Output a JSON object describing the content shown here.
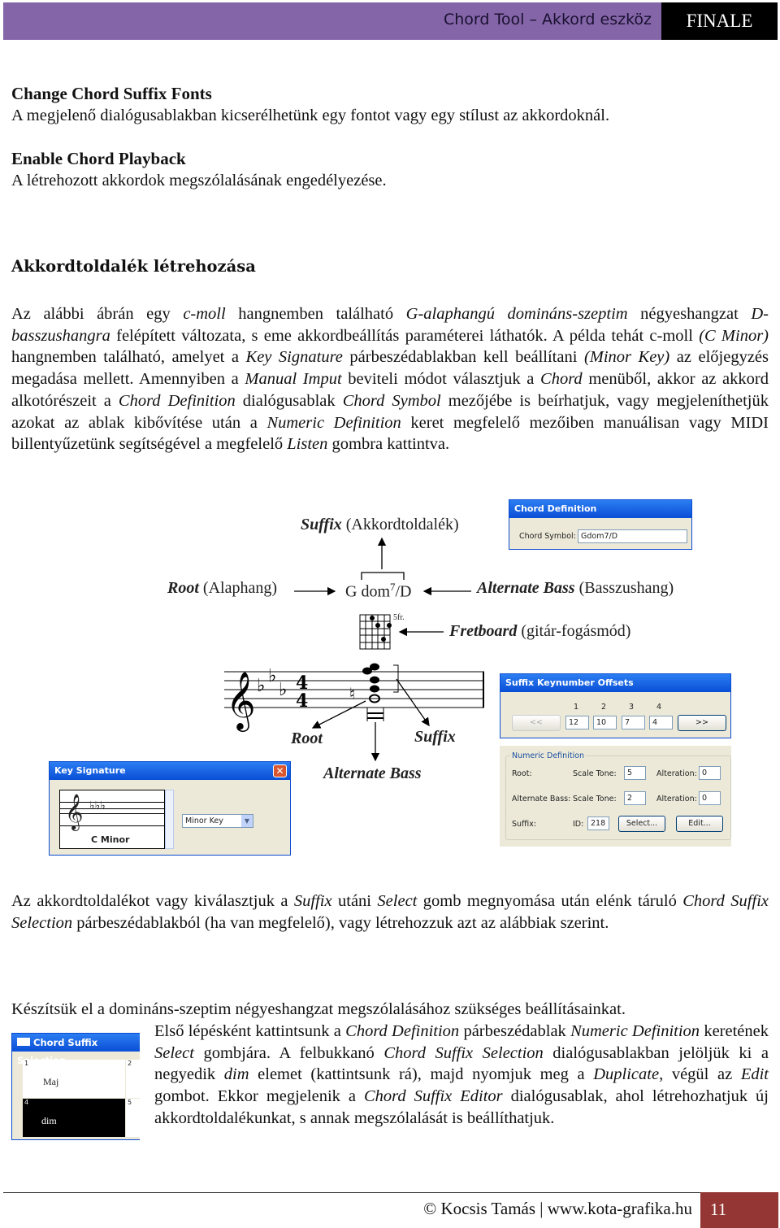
{
  "header": {
    "title": "Chord Tool – Akkord eszköz",
    "brand": "FINALE",
    "accent": "#8466a8"
  },
  "sections": [
    {
      "title": "Change Chord Suffix Fonts",
      "text": "A megjelenő dialógusablakban kicserélhetünk egy fontot vagy egy stílust az akkordoknál."
    },
    {
      "title": "Enable Chord Playback",
      "text": "A létrehozott akkordok megszólalásának engedélyezése."
    }
  ],
  "heading": "Akkordtoldalék létrehozása",
  "para1": [
    [
      "Az alábbi ábrán egy ",
      0
    ],
    [
      "c-moll",
      1
    ],
    [
      " hangnemben található ",
      0
    ],
    [
      "G-alaphangú domináns-szeptim",
      1
    ],
    [
      " négyeshangzat ",
      0
    ],
    [
      "D-basszushangra",
      1
    ],
    [
      " felépített változata, s eme akkordbeállítás paraméterei láthatók. A példa tehát c-moll ",
      0
    ],
    [
      "(C Minor)",
      1
    ],
    [
      " hangnemben található, amelyet a ",
      0
    ],
    [
      "Key Signature",
      1
    ],
    [
      " párbeszédablakban kell beállítani ",
      0
    ],
    [
      "(Minor Key)",
      1
    ],
    [
      " az előjegyzés megadása mellett. Amennyiben a ",
      0
    ],
    [
      "Manual Imput",
      1
    ],
    [
      " beviteli módot választjuk a ",
      0
    ],
    [
      "Chord",
      1
    ],
    [
      " menüből, akkor az akkord alkotórészeit a ",
      0
    ],
    [
      "Chord Definition",
      1
    ],
    [
      " dialógusablak ",
      0
    ],
    [
      "Chord Symbol",
      1
    ],
    [
      " mezőjébe is beírhatjuk, vagy megjeleníthetjük azokat az ablak kibővítése után a ",
      0
    ],
    [
      "Numeric Definition",
      1
    ],
    [
      " keret megfelelő mezőiben manuálisan vagy MIDI billentyűzetünk segítségével a megfelelő ",
      0
    ],
    [
      "Listen",
      1
    ],
    [
      " gombra kattintva.",
      0
    ]
  ],
  "diagram": {
    "suffix_label": "Suffix",
    "suffix_hu": "(Akkordtoldalék)",
    "root_label": "Root",
    "root_hu": "(Alaphang)",
    "chord_main": "G dom",
    "chord_sup": "7",
    "chord_bass": "/D",
    "altbass_label": "Alternate Bass",
    "altbass_hu": "(Basszushang)",
    "fret_label": "Fretboard",
    "fret_hu": "(gitár-fogásmód)",
    "fret_pos": "5fr.",
    "staff_root": "Root",
    "staff_suffix": "Suffix",
    "staff_altbass": "Alternate Bass"
  },
  "chord_definition": {
    "title": "Chord Definition",
    "symbol_label": "Chord Symbol:",
    "symbol_value": "Gdom7/D"
  },
  "keynumber_offsets": {
    "title": "Suffix Keynumber Offsets",
    "prev": "<<",
    "next": ">>",
    "columns": [
      "1",
      "2",
      "3",
      "4"
    ],
    "values": [
      "12",
      "10",
      "7",
      "4"
    ]
  },
  "numeric_definition": {
    "title": "Numeric Definition",
    "root_label": "Root:",
    "scale_tone_label": "Scale Tone:",
    "alteration_label": "Alteration:",
    "root_scale": "5",
    "root_alt": "0",
    "altbass_label": "Alternate Bass:",
    "altbass_scale": "2",
    "altbass_alt": "0",
    "suffix_label": "Suffix:",
    "id_label": "ID:",
    "id_value": "218",
    "select": "Select...",
    "edit": "Edit..."
  },
  "key_signature": {
    "title": "Key Signature",
    "key_name": "C Minor",
    "mode": "Minor Key"
  },
  "para2": [
    [
      "Az akkordtoldalékot vagy kiválasztjuk a ",
      0
    ],
    [
      "Suffix",
      1
    ],
    [
      " utáni ",
      0
    ],
    [
      "Select",
      1
    ],
    [
      " gomb megnyomása után elénk táruló ",
      0
    ],
    [
      "Chord Suffix Selection",
      1
    ],
    [
      " párbeszédablakból (ha van megfelelő), vagy létrehozzuk azt az alábbiak szerint.",
      0
    ]
  ],
  "para3_lead": "Készítsük el a domináns-szeptim négyeshangzat megszólalásához szükséges beállításainkat.",
  "para3": [
    [
      "Első lépésként kattintsunk a ",
      0
    ],
    [
      "Chord Definition",
      1
    ],
    [
      " párbeszédablak ",
      0
    ],
    [
      "Numeric Definition",
      1
    ],
    [
      " keretének ",
      0
    ],
    [
      "Select",
      1
    ],
    [
      " gombjára. A felbukkanó ",
      0
    ],
    [
      "Chord Suffix Selection",
      1
    ],
    [
      " dialógusablakban jelöljük ki a negyedik ",
      0
    ],
    [
      "dim",
      1
    ],
    [
      " elemet (kattintsunk rá), majd nyomjuk meg a ",
      0
    ],
    [
      "Duplicate",
      1
    ],
    [
      ", végül az ",
      0
    ],
    [
      "Edit",
      1
    ],
    [
      " gombot. Ekkor megjelenik a ",
      0
    ],
    [
      "Chord Suffix Editor",
      1
    ],
    [
      " dialógusablak, ahol létrehozhatjuk új akkordtoldalékunkat, s annak megszólalását is beállíthatjuk.",
      0
    ]
  ],
  "suffix_selection": {
    "title": "Chord Suffix Selection",
    "cells": [
      {
        "num": "1",
        "label": "Maj"
      },
      {
        "num": "2",
        "label": ""
      },
      {
        "num": "4",
        "label": "dim"
      },
      {
        "num": "5",
        "label": ""
      }
    ]
  },
  "footer": {
    "copyright": "© Kocsis Tamás | www.kota-grafika.hu",
    "page": "11",
    "page_color": "#943634"
  }
}
